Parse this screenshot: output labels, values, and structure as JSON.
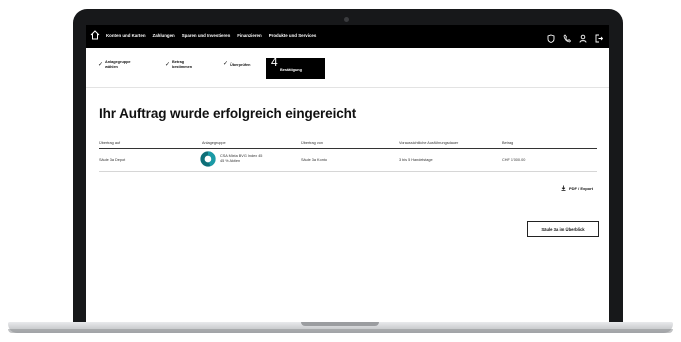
{
  "nav": {
    "items": [
      "Konten und Karten",
      "Zahlungen",
      "Sparen und Investieren",
      "Finanzieren",
      "Produkte und Services"
    ],
    "icons": [
      "home-icon",
      "shield-icon",
      "phone-icon",
      "user-icon",
      "logout-icon"
    ]
  },
  "stepper": {
    "steps": [
      {
        "label_line1": "Anlagegruppe",
        "label_line2": "wählen",
        "state": "done"
      },
      {
        "label_line1": "Betrag",
        "label_line2": "bestimmen",
        "state": "done"
      },
      {
        "label_line1": "Überprüfen",
        "label_line2": "",
        "state": "done"
      },
      {
        "number": "4",
        "label": "Bestätigung",
        "state": "active"
      }
    ]
  },
  "page": {
    "title": "Ihr Auftrag wurde erfolgreich eingereicht"
  },
  "table": {
    "headers": [
      "Übertrag auf",
      "Anlagegruppe",
      "Übertrag von",
      "Voraussichtliche Ausführungsdauer",
      "Betrag"
    ],
    "rows": [
      {
        "to": "Säule 3a Depot",
        "fund_line1": "CSA Mixta BVG Index 45",
        "fund_line2": "45 % Aktien",
        "fund_share_percent": 45,
        "from": "Säule 3a Konto",
        "duration": "3 bis 5 Handelstage",
        "amount": "CHF 1'000.00"
      }
    ]
  },
  "actions": {
    "export_label": "PDF / Export",
    "overview_label": "Säule 3a im Überblick"
  },
  "colors": {
    "accent": "#1a9aa6",
    "nav_bg": "#000000",
    "donut_track": "#0e6f78"
  }
}
